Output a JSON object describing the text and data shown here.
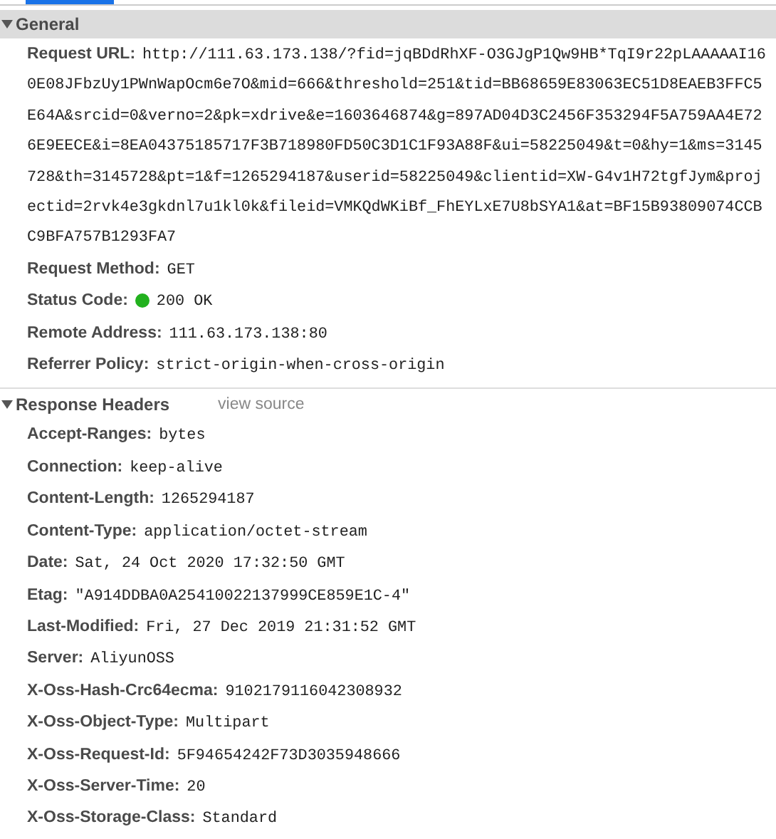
{
  "sections": [
    {
      "title": "General",
      "expanded": true,
      "rows": [
        {
          "name": "Request URL:",
          "kind": "wrapped",
          "value": "http://111.63.173.138/?fid=jqBDdRhXF-O3GJgP1Qw9HB*TqI9r22pLAAAAAI160E08JFbzUy1PWnWapOcm6e7O&mid=666&threshold=251&tid=BB68659E83063EC51D8EAEB3FFC5E64A&srcid=0&verno=2&pk=xdrive&e=1603646874&g=897AD04D3C2456F353294F5A759AA4E726E9EECE&i=8EA04375185717F3B718980FD50C3D1C1F93A88F&ui=58225049&t=0&hy=1&ms=3145728&th=3145728&pt=1&f=1265294187&userid=58225049&clientid=XW-G4v1H72tgfJym&projectid=2rvk4e3gkdnl7u1kl0k&fileid=VMKQdWKiBf_FhEYLxE7U8bSYA1&at=BF15B93809074CCBC9BFA757B1293FA7"
        },
        {
          "name": "Request Method:",
          "value": "GET"
        },
        {
          "name": "Status Code:",
          "value": "200 OK",
          "color": "#22b11e"
        },
        {
          "name": "Remote Address:",
          "value": "111.63.173.138:80"
        },
        {
          "name": "Referrer Policy:",
          "value": "strict-origin-when-cross-origin"
        }
      ]
    },
    {
      "title": "Response Headers",
      "expanded": true,
      "link": "view source",
      "rows": [
        {
          "name": "Accept-Ranges:",
          "value": "bytes"
        },
        {
          "name": "Connection:",
          "value": "keep-alive"
        },
        {
          "name": "Content-Length:",
          "value": "1265294187"
        },
        {
          "name": "Content-Type:",
          "value": "application/octet-stream"
        },
        {
          "name": "Date:",
          "value": "Sat, 24 Oct 2020 17:32:50 GMT"
        },
        {
          "name": "Etag:",
          "value": "\"A914DDBA0A25410022137999CE859E1C-4\""
        },
        {
          "name": "Last-Modified:",
          "value": "Fri, 27 Dec 2019 21:31:52 GMT"
        },
        {
          "name": "Server:",
          "value": "AliyunOSS"
        },
        {
          "name": "X-Oss-Hash-Crc64ecma:",
          "value": "9102179116042308932"
        },
        {
          "name": "X-Oss-Object-Type:",
          "value": "Multipart"
        },
        {
          "name": "X-Oss-Request-Id:",
          "value": "5F94654242F73D3035948666"
        },
        {
          "name": "X-Oss-Server-Time:",
          "value": "20"
        },
        {
          "name": "X-Oss-Storage-Class:",
          "value": "Standard"
        }
      ]
    }
  ]
}
